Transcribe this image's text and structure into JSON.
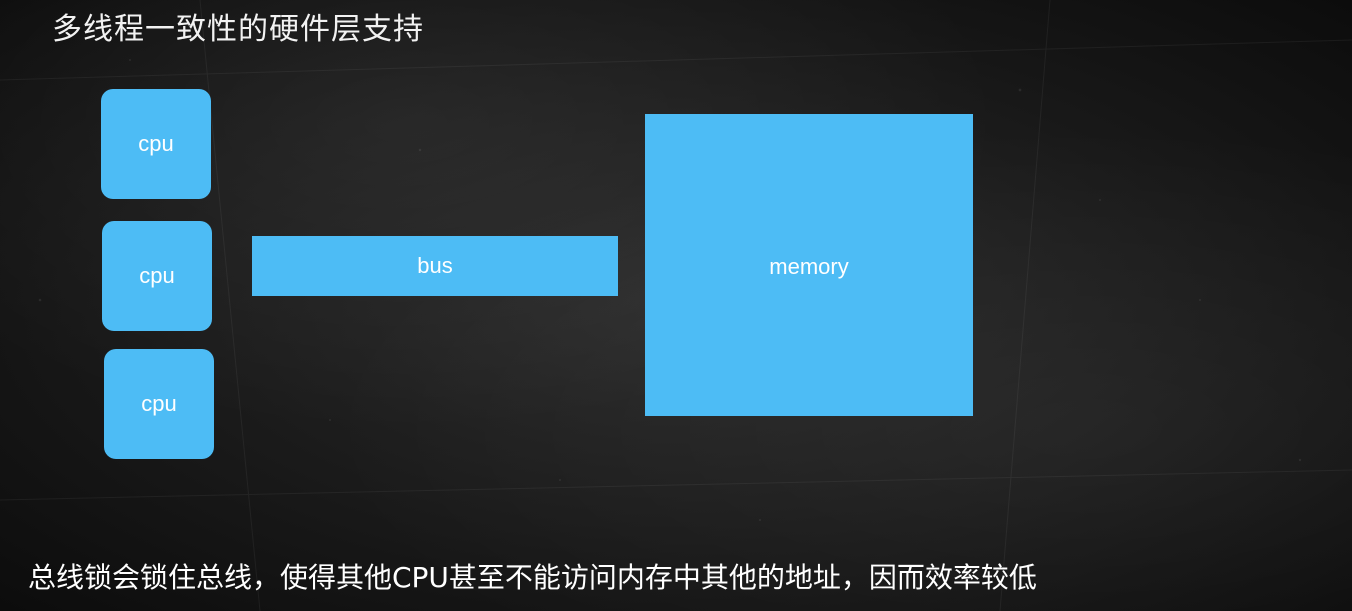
{
  "title": "多线程一致性的硬件层支持",
  "diagram": {
    "cpus": [
      "cpu",
      "cpu",
      "cpu"
    ],
    "bus_label": "bus",
    "memory_label": "memory",
    "box_color": "#4dbcf5"
  },
  "caption": "总线锁会锁住总线，使得其他CPU甚至不能访问内存中其他的地址，因而效率较低"
}
